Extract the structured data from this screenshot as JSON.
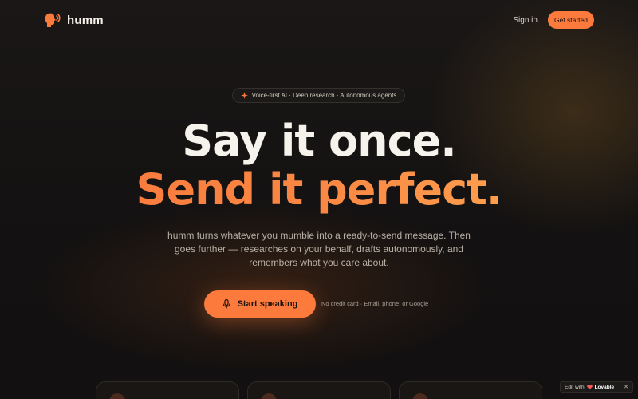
{
  "nav": {
    "brand": "humm",
    "sign_in": "Sign in",
    "get_started": "Get started"
  },
  "hero": {
    "pill_text": "Voice-first AI · Deep research · Autonomous agents",
    "headline_line1": "Say it once.",
    "headline_line2": "Send it perfect.",
    "subheading": "humm turns whatever you mumble into a ready-to-send message. Then goes further — researches on your behalf, drafts autonomously, and remembers what you care about.",
    "cta_label": "Start speaking",
    "cta_note": "No credit card · Email, phone, or Google"
  },
  "badge": {
    "prefix": "Edit with",
    "brand": "Lovable",
    "close": "✕"
  },
  "icons": {
    "brand": "speaking-head-icon",
    "pill": "sparkle-icon",
    "cta": "microphone-icon",
    "badge": "heart-icon"
  },
  "colors": {
    "accent": "#fb7a3c",
    "accent_light": "#ffb156",
    "background": "#141212",
    "text": "#f6f2ec"
  }
}
